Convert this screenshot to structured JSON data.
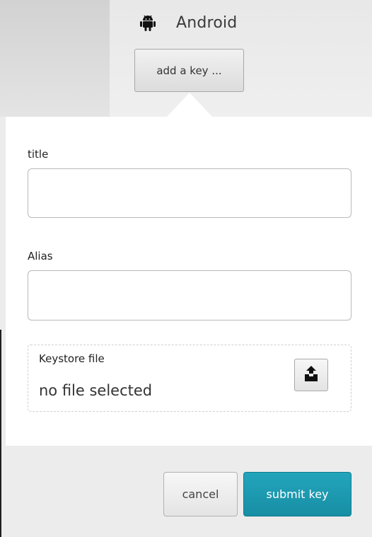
{
  "header": {
    "platform_icon": "android-icon",
    "platform_label": "Android",
    "add_key_label": "add a key ..."
  },
  "form": {
    "title_label": "title",
    "title_value": "",
    "alias_label": "Alias",
    "alias_value": "",
    "keystore_label": "Keystore file",
    "keystore_status": "no file selected",
    "upload_icon": "upload-icon"
  },
  "footer": {
    "cancel_label": "cancel",
    "submit_label": "submit key"
  },
  "colors": {
    "accent": "#1c9bb2",
    "panel_bg": "#ffffff",
    "page_bg": "#ececec"
  }
}
